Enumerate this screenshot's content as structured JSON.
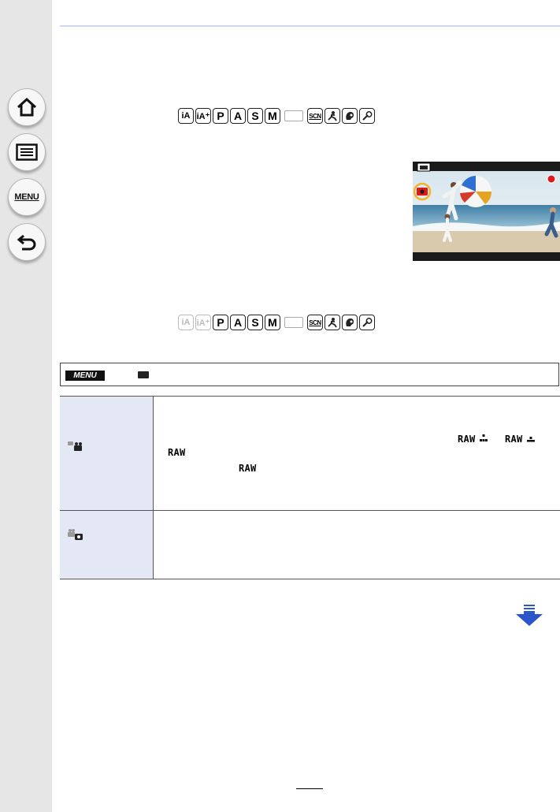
{
  "sidebar": {
    "buttons": [
      {
        "name": "home-icon"
      },
      {
        "name": "list-icon"
      },
      {
        "name": "menu-icon",
        "label": "MENU"
      },
      {
        "name": "back-icon"
      }
    ]
  },
  "mode_rows": [
    {
      "modes": [
        "iA",
        "iA+",
        "P",
        "A",
        "S",
        "M",
        "custom",
        "SCN",
        "guide",
        "portrait",
        "creative"
      ],
      "enabled": [
        true,
        true,
        true,
        true,
        true,
        true,
        false,
        true,
        true,
        true,
        true
      ]
    },
    {
      "modes": [
        "iA",
        "iA+",
        "P",
        "A",
        "S",
        "M",
        "custom",
        "SCN",
        "guide",
        "portrait",
        "creative"
      ],
      "enabled": [
        false,
        false,
        true,
        true,
        true,
        true,
        false,
        true,
        true,
        true,
        true
      ]
    }
  ],
  "menu_path": {
    "menu_label": "MENU",
    "icon": "motion-picture-icon"
  },
  "table": {
    "rows": [
      {
        "icon": "photo-priority-icon",
        "raw_labels": [
          "RAW",
          "RAW",
          "RAW",
          "RAW"
        ]
      },
      {
        "icon": "video-priority-icon"
      }
    ]
  },
  "colors": {
    "sidebar_bg": "#e6e6e6",
    "table_header_bg": "#e3e8f4",
    "arrow": "#2b56c9",
    "highlight_ring": "#f2b22a",
    "record_dot": "#e0181c"
  }
}
